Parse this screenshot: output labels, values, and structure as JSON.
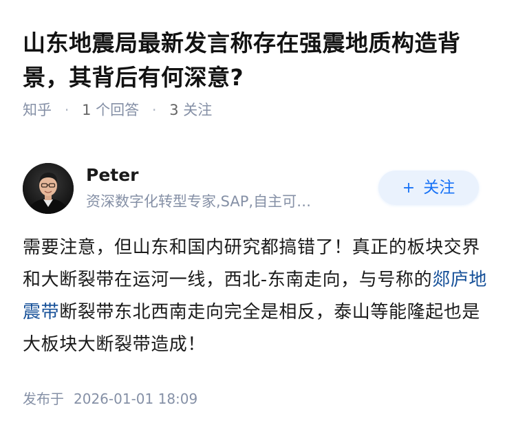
{
  "question": {
    "title": "山东地震局最新发言称存在强震地质构造背景，其背后有何深意?",
    "meta": {
      "site": "知乎",
      "answers_count": "1",
      "answers_label": "个回答",
      "followers_count": "3",
      "followers_label": "关注"
    }
  },
  "answer": {
    "author": {
      "name": "Peter",
      "bio": "资深数字化转型专家,SAP,自主可…",
      "avatar_icon": "person-avatar"
    },
    "follow_button": {
      "label": "关注",
      "icon": "plus-icon"
    },
    "content": {
      "part1": "需要注意，但山东和国内研究都搞错了！真正的板块交界和大断裂带在运河一线，西北-东南走向，与号称的",
      "link": "郯庐地震带",
      "part2": "断裂带东北西南走向完全是相反，泰山等能隆起也是大板块大断裂带造成！"
    },
    "published": {
      "label": "发布于",
      "time": "2026-01-01 18:09"
    }
  },
  "colors": {
    "primary_blue": "#1772f6",
    "link_blue": "#175199",
    "meta_gray": "#8590a6",
    "button_bg": "#eaf2fd",
    "text": "#1a1a1a"
  }
}
